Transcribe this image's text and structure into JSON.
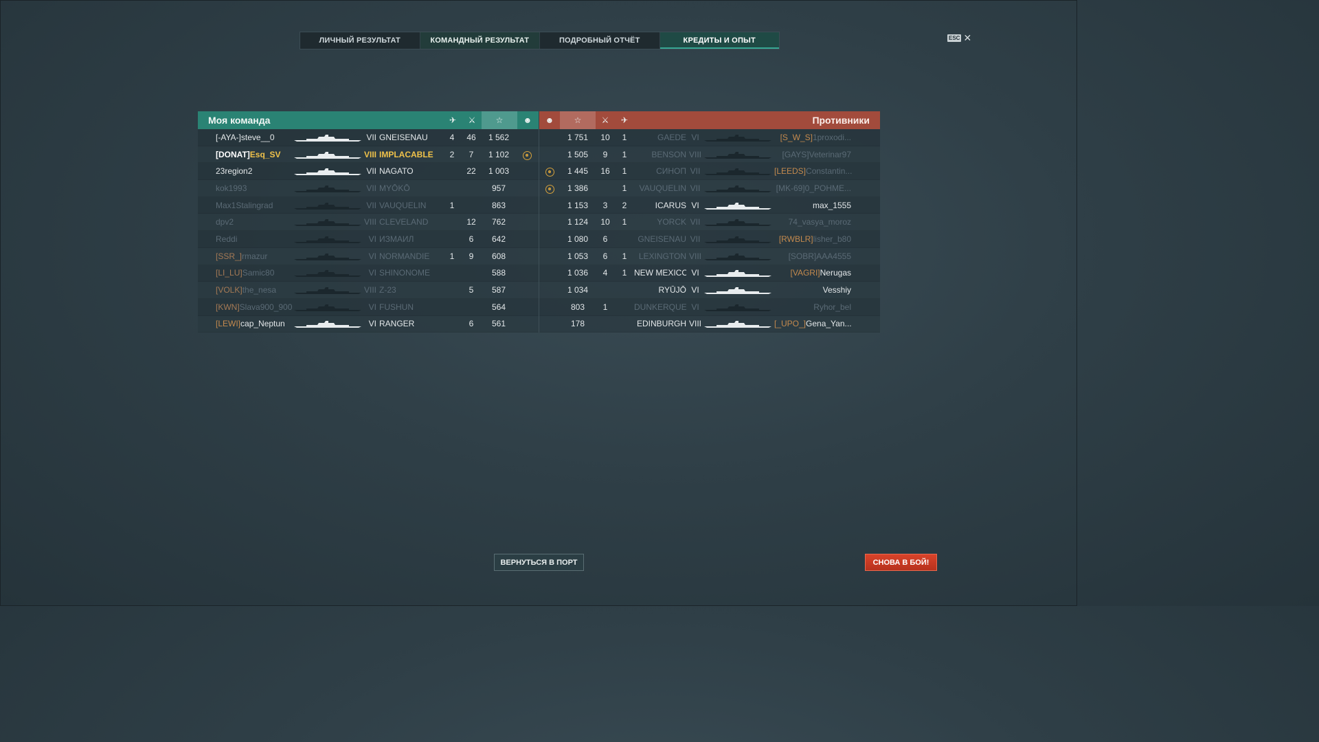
{
  "tabs": [
    {
      "label": "ЛИЧНЫЙ РЕЗУЛЬТАТ"
    },
    {
      "label": "КОМАНДНЫЙ РЕЗУЛЬТАТ"
    },
    {
      "label": "ПОДРОБНЫЙ ОТЧЁТ"
    },
    {
      "label": "КРЕДИТЫ И ОПЫТ"
    }
  ],
  "esc": {
    "badge": "ESC",
    "close": "✕"
  },
  "my_team": {
    "title": "Моя команда",
    "icons": {
      "planes": "✈",
      "kills": "⚔",
      "score": "☆",
      "medal": "☻"
    },
    "rows": [
      {
        "clan": "[-AYA-]",
        "name": "steve__0",
        "tier": "VII",
        "ship": "GNEISENAU",
        "c1": "4",
        "c2": "46",
        "c3": "1 562",
        "c4": "",
        "state": "alive"
      },
      {
        "clan": "[DONAT]",
        "name": "Esq_SV",
        "tier": "VIII",
        "ship": "IMPLACABLE",
        "c1": "2",
        "c2": "7",
        "c3": "1 102",
        "c4": "☻",
        "state": "me"
      },
      {
        "clan": "",
        "name": "23region2",
        "tier": "VII",
        "ship": "NAGATO",
        "c1": "",
        "c2": "22",
        "c3": "1 003",
        "c4": "",
        "state": "alive"
      },
      {
        "clan": "",
        "name": "kok1993",
        "tier": "VII",
        "ship": "MYŌKŌ",
        "c1": "",
        "c2": "",
        "c3": "957",
        "c4": "",
        "state": "dead"
      },
      {
        "clan": "",
        "name": "Max1Stalingrad",
        "tier": "VII",
        "ship": "VAUQUELIN",
        "c1": "1",
        "c2": "",
        "c3": "863",
        "c4": "",
        "state": "dead"
      },
      {
        "clan": "",
        "name": "dpv2",
        "tier": "VIII",
        "ship": "CLEVELAND",
        "c1": "",
        "c2": "12",
        "c3": "762",
        "c4": "",
        "state": "dead"
      },
      {
        "clan": "",
        "name": "Reddi",
        "tier": "VI",
        "ship": "ИЗМАИЛ",
        "c1": "",
        "c2": "6",
        "c3": "642",
        "c4": "",
        "state": "dead"
      },
      {
        "clan": "[SSR_]",
        "name": "rmazur",
        "tier": "VI",
        "ship": "NORMANDIE",
        "c1": "1",
        "c2": "9",
        "c3": "608",
        "c4": "",
        "state": "dead"
      },
      {
        "clan": "[LI_LU]",
        "name": "Samic80",
        "tier": "VI",
        "ship": "SHINONOME",
        "c1": "",
        "c2": "",
        "c3": "588",
        "c4": "",
        "state": "dead"
      },
      {
        "clan": "[VOLK]",
        "name": "the_nesa",
        "tier": "VIII",
        "ship": "Z-23",
        "c1": "",
        "c2": "5",
        "c3": "587",
        "c4": "",
        "state": "dead"
      },
      {
        "clan": "[KWN]",
        "name": "Slava900_900",
        "tier": "VI",
        "ship": "FUSHUN",
        "c1": "",
        "c2": "",
        "c3": "564",
        "c4": "",
        "state": "dead"
      },
      {
        "clan": "[LEWI]",
        "name": "cap_Neptun",
        "tier": "VI",
        "ship": "RANGER",
        "c1": "",
        "c2": "6",
        "c3": "561",
        "c4": "",
        "state": "alive"
      }
    ]
  },
  "enemies": {
    "title": "Противники",
    "rows": [
      {
        "c4": "",
        "c3": "1 751",
        "c2": "10",
        "c1": "1",
        "ship": "GAEDE",
        "tier": "VI",
        "clan": "[S_W_S]",
        "name": "1proxodi...",
        "state": "dead"
      },
      {
        "c4": "",
        "c3": "1 505",
        "c2": "9",
        "c1": "1",
        "ship": "BENSON",
        "tier": "VIII",
        "clan": "[GAYS]",
        "name": "Veterinar97",
        "state": "dead"
      },
      {
        "c4": "☻",
        "c3": "1 445",
        "c2": "16",
        "c1": "1",
        "ship": "СИНОП",
        "tier": "VII",
        "clan": "[LEEDS]",
        "name": "Constantin...",
        "state": "dead"
      },
      {
        "c4": "☻",
        "c3": "1 386",
        "c2": "",
        "c1": "1",
        "ship": "VAUQUELIN",
        "tier": "VII",
        "clan": "[MK-69]",
        "name": "0_POHME...",
        "state": "dead"
      },
      {
        "c4": "",
        "c3": "1 153",
        "c2": "3",
        "c1": "2",
        "ship": "ICARUS",
        "tier": "VI",
        "clan": "",
        "name": "max_1555",
        "state": "alive"
      },
      {
        "c4": "",
        "c3": "1 124",
        "c2": "10",
        "c1": "1",
        "ship": "YORCK",
        "tier": "VII",
        "clan": "",
        "name": "74_vasya_moroz",
        "state": "dead"
      },
      {
        "c4": "",
        "c3": "1 080",
        "c2": "6",
        "c1": "",
        "ship": "GNEISENAU",
        "tier": "VII",
        "clan": "[RWBLR]",
        "name": "lisher_b80",
        "state": "dead"
      },
      {
        "c4": "",
        "c3": "1 053",
        "c2": "6",
        "c1": "1",
        "ship": "LEXINGTON",
        "tier": "VIII",
        "clan": "[SOBR]",
        "name": "AAA4555",
        "state": "dead"
      },
      {
        "c4": "",
        "c3": "1 036",
        "c2": "4",
        "c1": "1",
        "ship": "NEW MEXICO",
        "tier": "VI",
        "clan": "[VAGRI]",
        "name": "Nerugas",
        "state": "alive"
      },
      {
        "c4": "",
        "c3": "1 034",
        "c2": "",
        "c1": "",
        "ship": "RYŪJŌ",
        "tier": "VI",
        "clan": "",
        "name": "Vesshiy",
        "state": "alive"
      },
      {
        "c4": "",
        "c3": "803",
        "c2": "1",
        "c1": "",
        "ship": "DUNKERQUE",
        "tier": "VI",
        "clan": "",
        "name": "Ryhor_bel",
        "state": "dead"
      },
      {
        "c4": "",
        "c3": "178",
        "c2": "",
        "c1": "",
        "ship": "EDINBURGH",
        "tier": "VIII",
        "clan": "[_UPO_]",
        "name": "Gena_Yan...",
        "state": "alive"
      }
    ]
  },
  "buttons": {
    "port": "ВЕРНУТЬСЯ В ПОРТ",
    "battle": "СНОВА В БОЙ!"
  },
  "colors": {
    "team": "#2a8374",
    "enemy": "#a24b3c",
    "battle_button": "#c93a22",
    "player_gold": "#f0c24a",
    "clan_tag": "#c48a4e"
  }
}
